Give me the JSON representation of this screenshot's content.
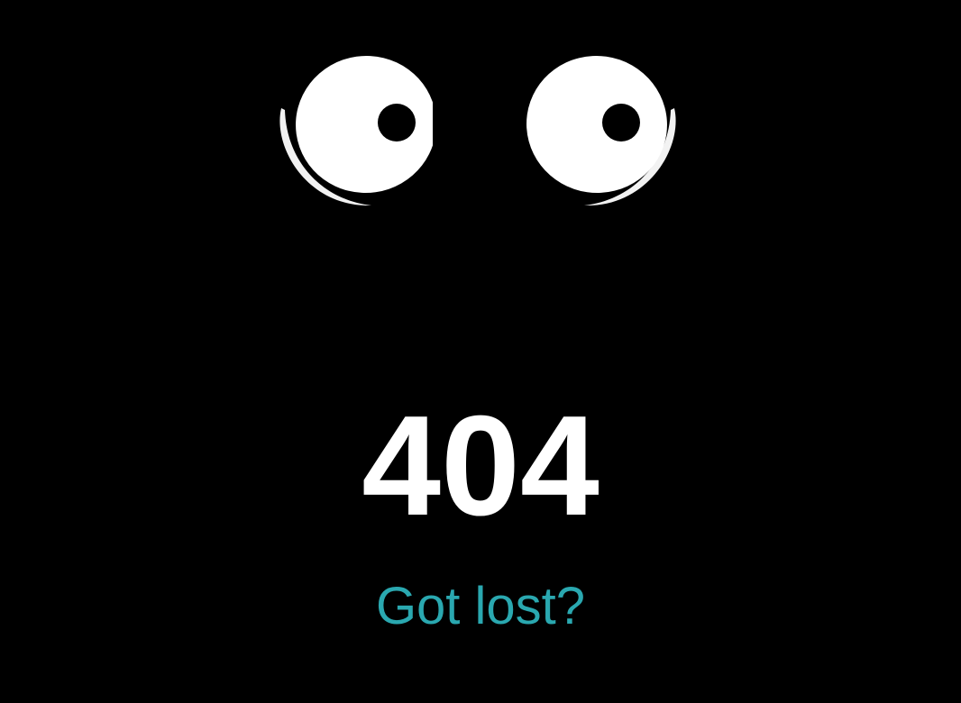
{
  "error": {
    "code": "404",
    "link_text": "Got lost?"
  },
  "eyes": {
    "left_icon": "eye-icon",
    "right_icon": "eye-icon"
  },
  "colors": {
    "background": "#000000",
    "eye_white": "#ffffff",
    "pupil": "#000000",
    "code_text": "#ffffff",
    "link_text": "#2aa8b0"
  }
}
